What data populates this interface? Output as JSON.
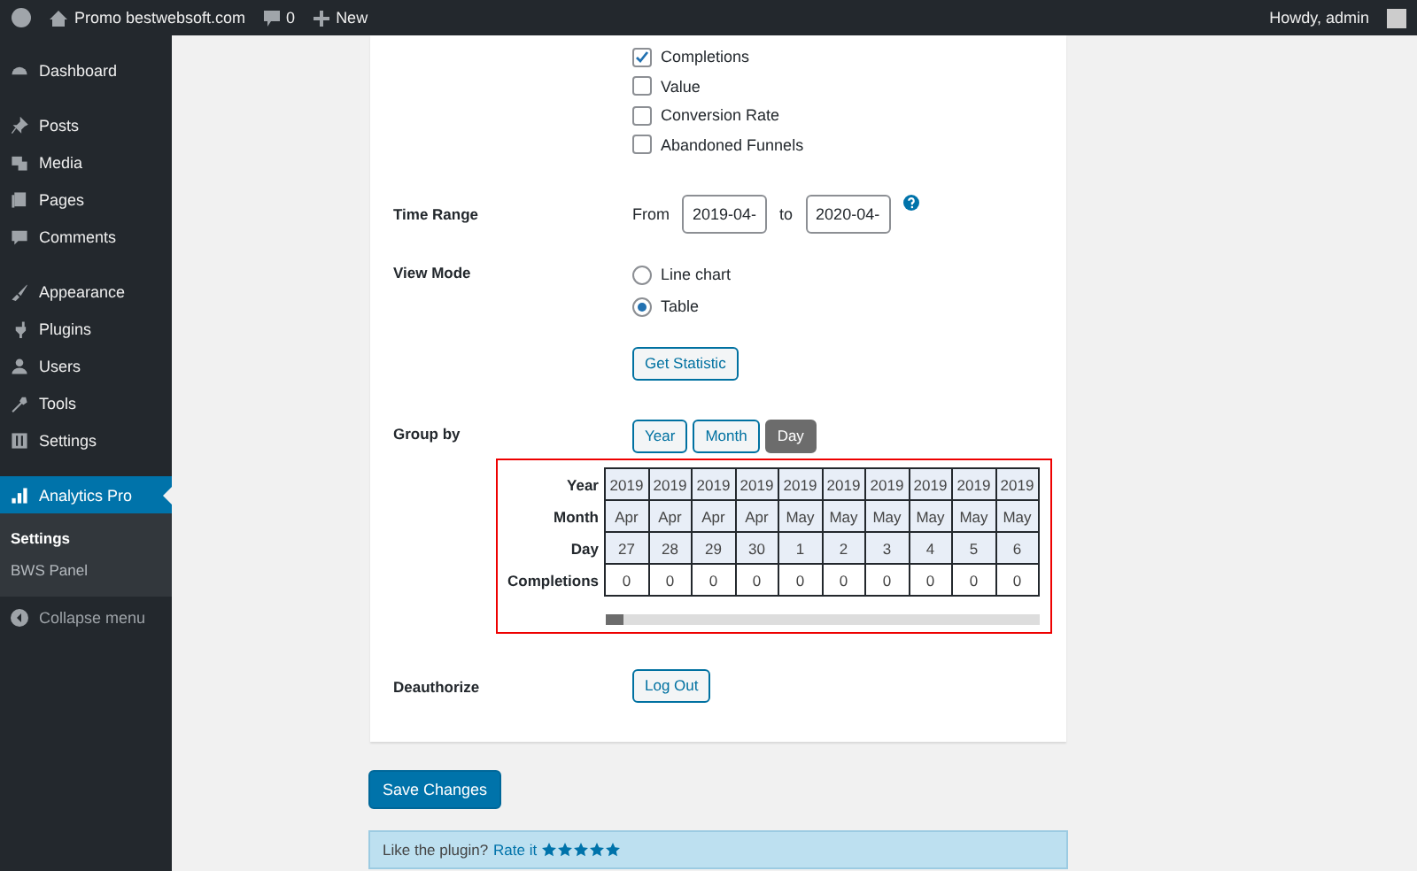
{
  "admin_bar": {
    "site": "Promo bestwebsoft.com",
    "comments": "0",
    "new": "New",
    "greeting": "Howdy, admin"
  },
  "sidebar": {
    "groups": [
      [
        {
          "label": "Dashboard",
          "selected": false
        }
      ],
      [
        {
          "label": "Posts",
          "selected": false
        },
        {
          "label": "Media",
          "selected": false
        },
        {
          "label": "Pages",
          "selected": false
        },
        {
          "label": "Comments",
          "selected": false
        }
      ],
      [
        {
          "label": "Appearance",
          "selected": false
        },
        {
          "label": "Plugins",
          "selected": false
        },
        {
          "label": "Users",
          "selected": false
        },
        {
          "label": "Tools",
          "selected": false
        },
        {
          "label": "Settings",
          "selected": false
        }
      ],
      [
        {
          "label": "Analytics Pro",
          "selected": true
        }
      ]
    ],
    "submenu": [
      {
        "label": "Settings",
        "selected": true
      },
      {
        "label": "BWS Panel",
        "selected": false
      }
    ],
    "collapse": "Collapse menu"
  },
  "metrics": [
    {
      "label": "Completions",
      "checked": true
    },
    {
      "label": "Value",
      "checked": false
    },
    {
      "label": "Conversion Rate",
      "checked": false
    },
    {
      "label": "Abandoned Funnels",
      "checked": false
    }
  ],
  "time_range": {
    "label": "Time Range",
    "from_label": "From",
    "from": "2019-04-",
    "to_label": "to",
    "to": "2020-04-"
  },
  "view_mode": {
    "label": "View Mode",
    "options": [
      {
        "label": "Line chart",
        "selected": false
      },
      {
        "label": "Table",
        "selected": true
      }
    ]
  },
  "get_statistic": "Get Statistic",
  "group_by": {
    "label": "Group by",
    "options": [
      {
        "label": "Year",
        "selected": false
      },
      {
        "label": "Month",
        "selected": false
      },
      {
        "label": "Day",
        "selected": true
      }
    ]
  },
  "table": {
    "rows": [
      {
        "header": "Year",
        "cells": [
          "2019",
          "2019",
          "2019",
          "2019",
          "2019",
          "2019",
          "2019",
          "2019",
          "2019",
          "2019"
        ]
      },
      {
        "header": "Month",
        "cells": [
          "Apr",
          "Apr",
          "Apr",
          "Apr",
          "May",
          "May",
          "May",
          "May",
          "May",
          "May"
        ]
      },
      {
        "header": "Day",
        "cells": [
          "27",
          "28",
          "29",
          "30",
          "1",
          "2",
          "3",
          "4",
          "5",
          "6"
        ]
      },
      {
        "header": "Completions",
        "cells": [
          "0",
          "0",
          "0",
          "0",
          "0",
          "0",
          "0",
          "0",
          "0",
          "0"
        ]
      }
    ]
  },
  "deauthorize": {
    "label": "Deauthorize",
    "button": "Log Out"
  },
  "save_button": "Save Changes",
  "notice": {
    "text": "Like the plugin?",
    "link": "Rate it",
    "stars": 5
  }
}
